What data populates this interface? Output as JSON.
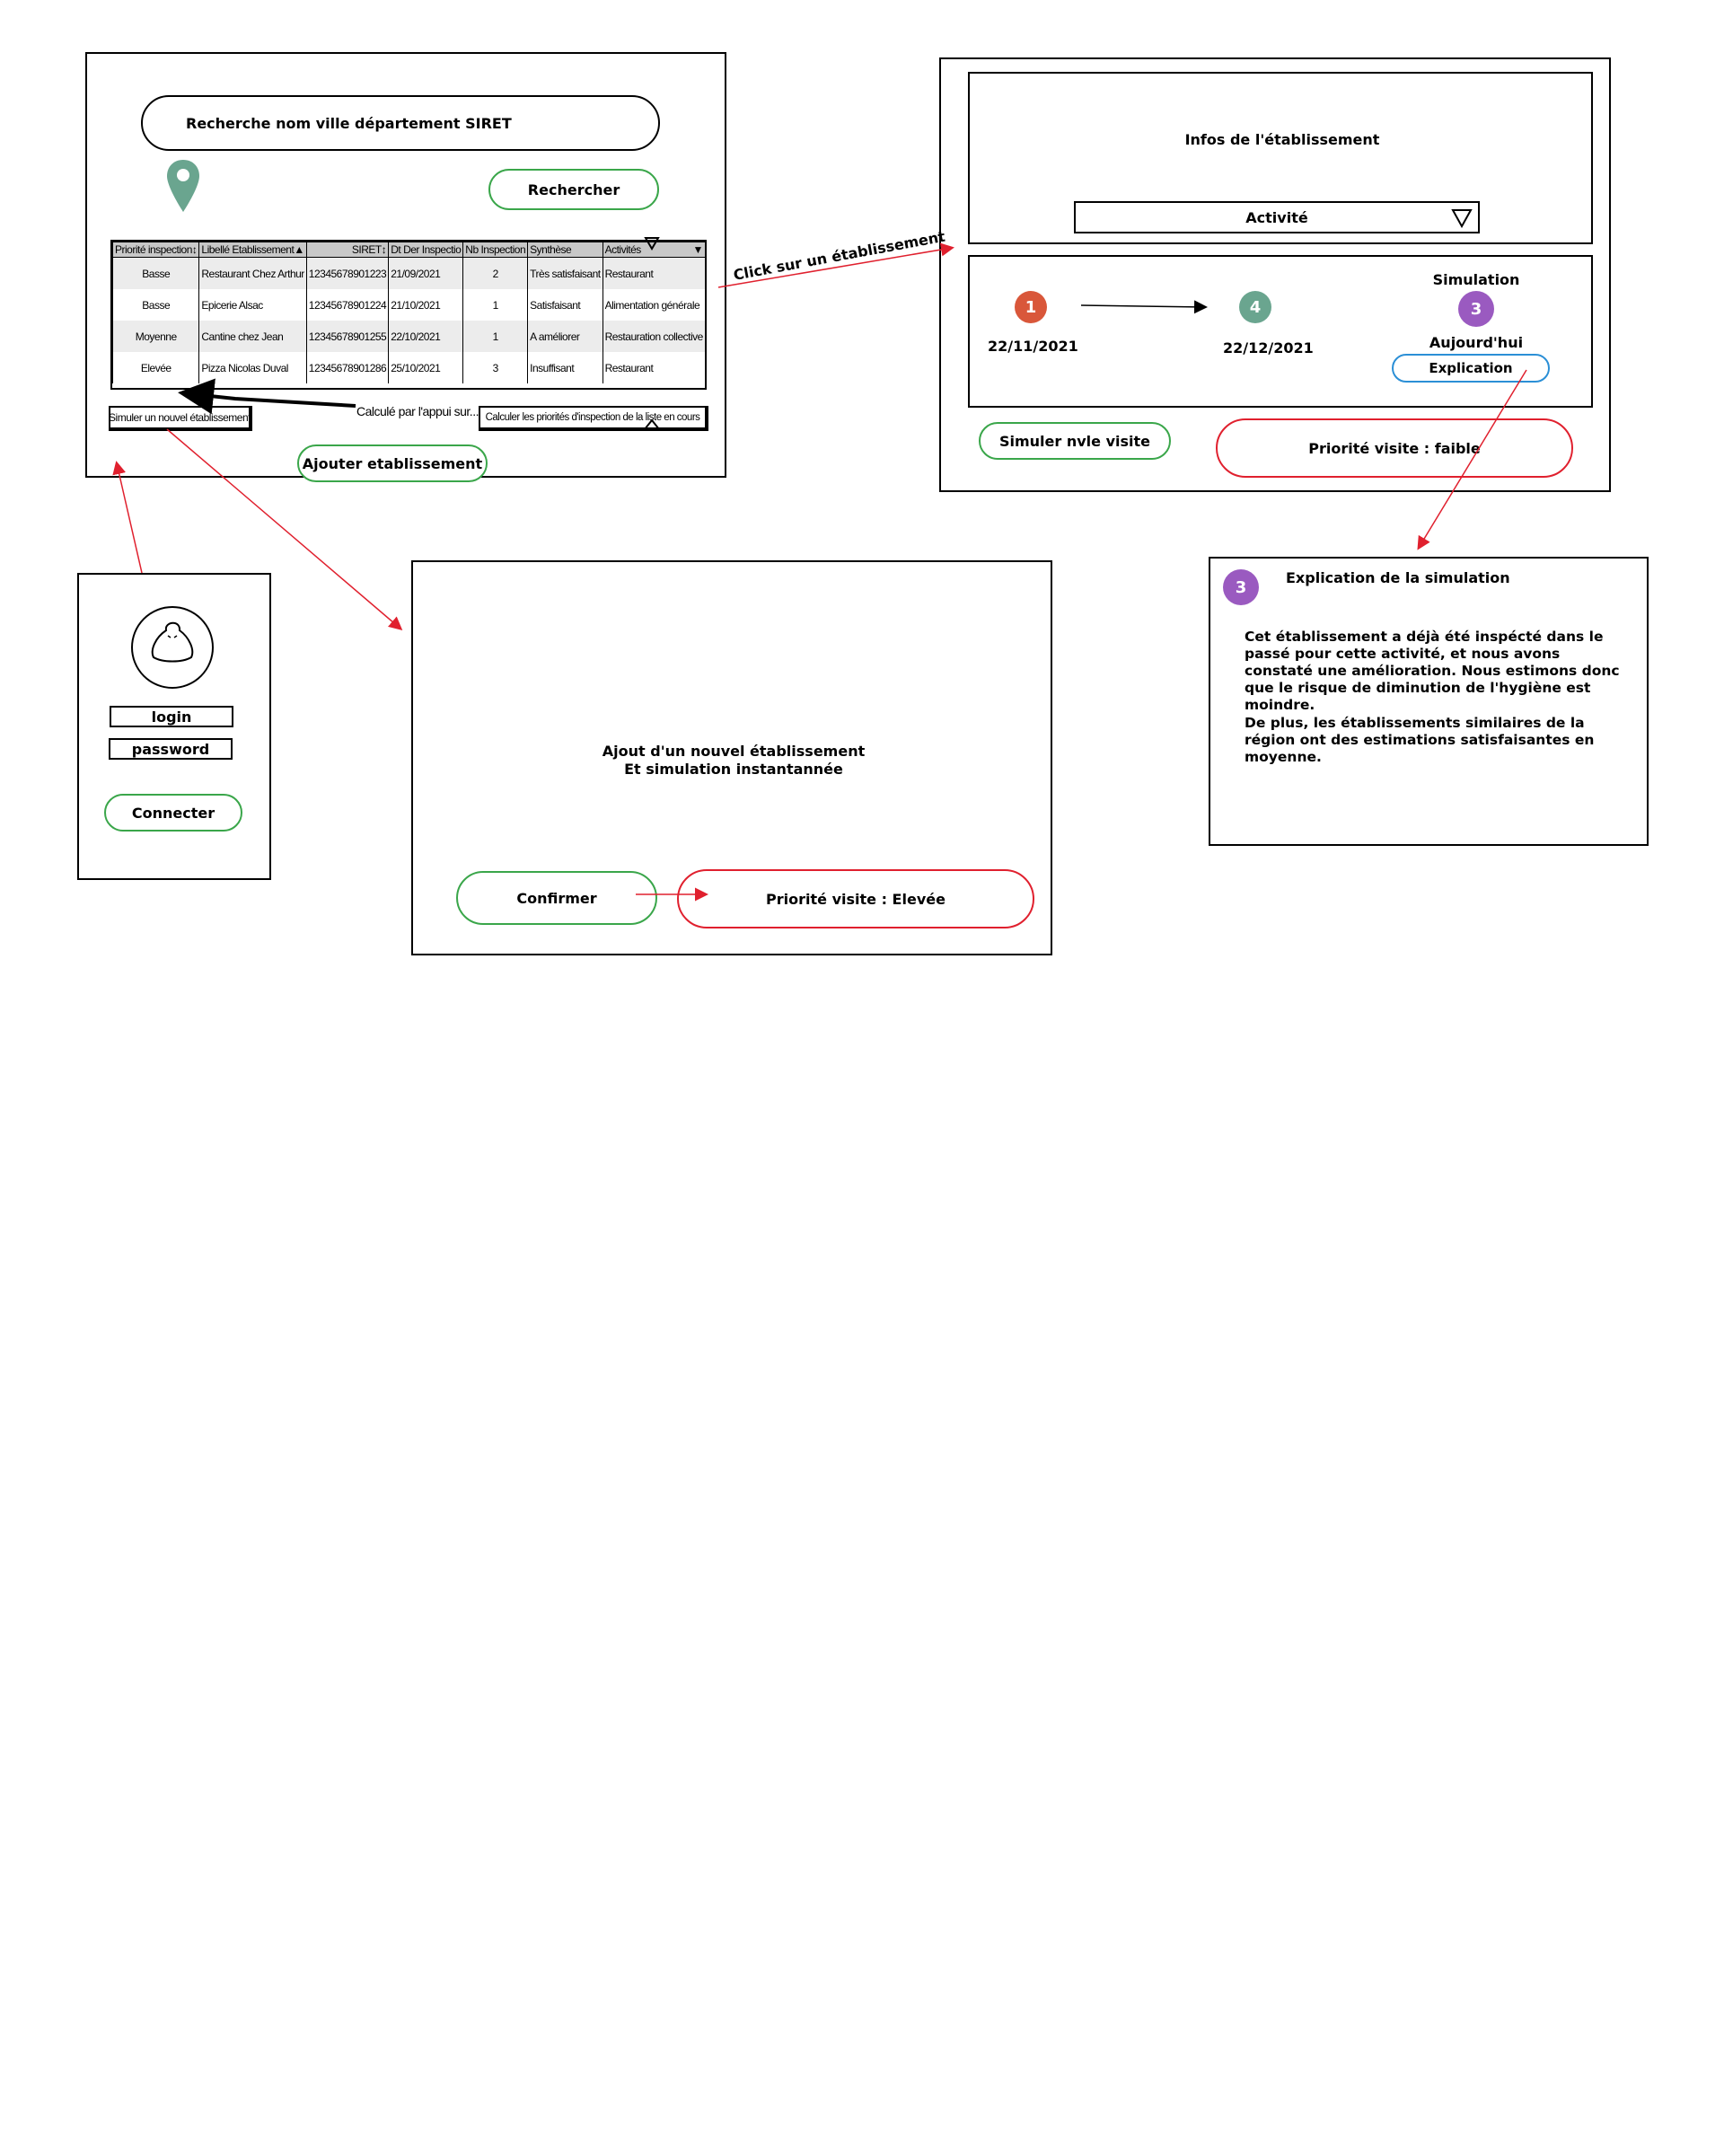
{
  "search_screen": {
    "search_placeholder": "Recherche nom ville département SIRET",
    "search_button": "Rechercher",
    "table": {
      "headers": [
        "Priorité inspection",
        "Libellé Etablissement",
        "SIRET",
        "Dt Der Inspectio",
        "Nb Inspection",
        "Synthèse",
        "Activités"
      ],
      "rows": [
        [
          "Basse",
          "Restaurant Chez Arthur",
          "12345678901223",
          "21/09/2021",
          "2",
          "Très satisfaisant",
          "Restaurant"
        ],
        [
          "Basse",
          "Epicerie Alsac",
          "12345678901224",
          "21/10/2021",
          "1",
          "Satisfaisant",
          "Alimentation générale"
        ],
        [
          "Moyenne",
          "Cantine chez Jean",
          "12345678901255",
          "22/10/2021",
          "1",
          "A améliorer",
          "Restauration collective"
        ],
        [
          "Elevée",
          "Pizza Nicolas Duval",
          "12345678901286",
          "25/10/2021",
          "3",
          "Insuffisant",
          "Restaurant"
        ]
      ]
    },
    "simulate_new_button": "Simuler un nouvel établissement",
    "calc_note": "Calculé par l'appui sur...",
    "calc_button": "Calculer les priorités d'inspection de la liste en cours",
    "add_button": "Ajouter etablissement"
  },
  "login_screen": {
    "login_label": "login",
    "password_label": "password",
    "connect_button": "Connecter"
  },
  "click_label": "Click sur un établissement",
  "detail_screen": {
    "info_title": "Infos de l'établissement",
    "activity_select": "Activité",
    "simulation_label": "Simulation",
    "timeline": [
      {
        "number": "1",
        "date": "22/11/2021",
        "color": "#d9573a"
      },
      {
        "number": "4",
        "date": "22/12/2021",
        "color": "#6aa58f"
      },
      {
        "number": "3",
        "date": "Aujourd'hui",
        "color": "#9a5ac0"
      }
    ],
    "explication_button": "Explication",
    "simulate_visit_button": "Simuler nvle visite",
    "priority_result": "Priorité visite : faible"
  },
  "explanation_panel": {
    "badge": "3",
    "title": "Explication de la simulation",
    "paragraph1": "Cet établissement a déjà été inspécté dans le passé pour cette activité, et nous avons constaté une amélioration. Nous estimons donc que le risque de diminution de l'hygiène est moindre.",
    "paragraph2": "De plus, les établissements similaires de la région ont des estimations satisfaisantes en moyenne."
  },
  "add_screen": {
    "title_line1": "Ajout d'un nouvel établissement",
    "title_line2": "Et simulation instantannée",
    "confirm_button": "Confirmer",
    "priority_result": "Priorité visite : Elevée"
  },
  "colors": {
    "green_border": "#3aa64a",
    "red_border": "#e0202e",
    "blue_border": "#2b8fd6",
    "arrow_red": "#e0202e",
    "pin_green": "#6aa58f"
  }
}
